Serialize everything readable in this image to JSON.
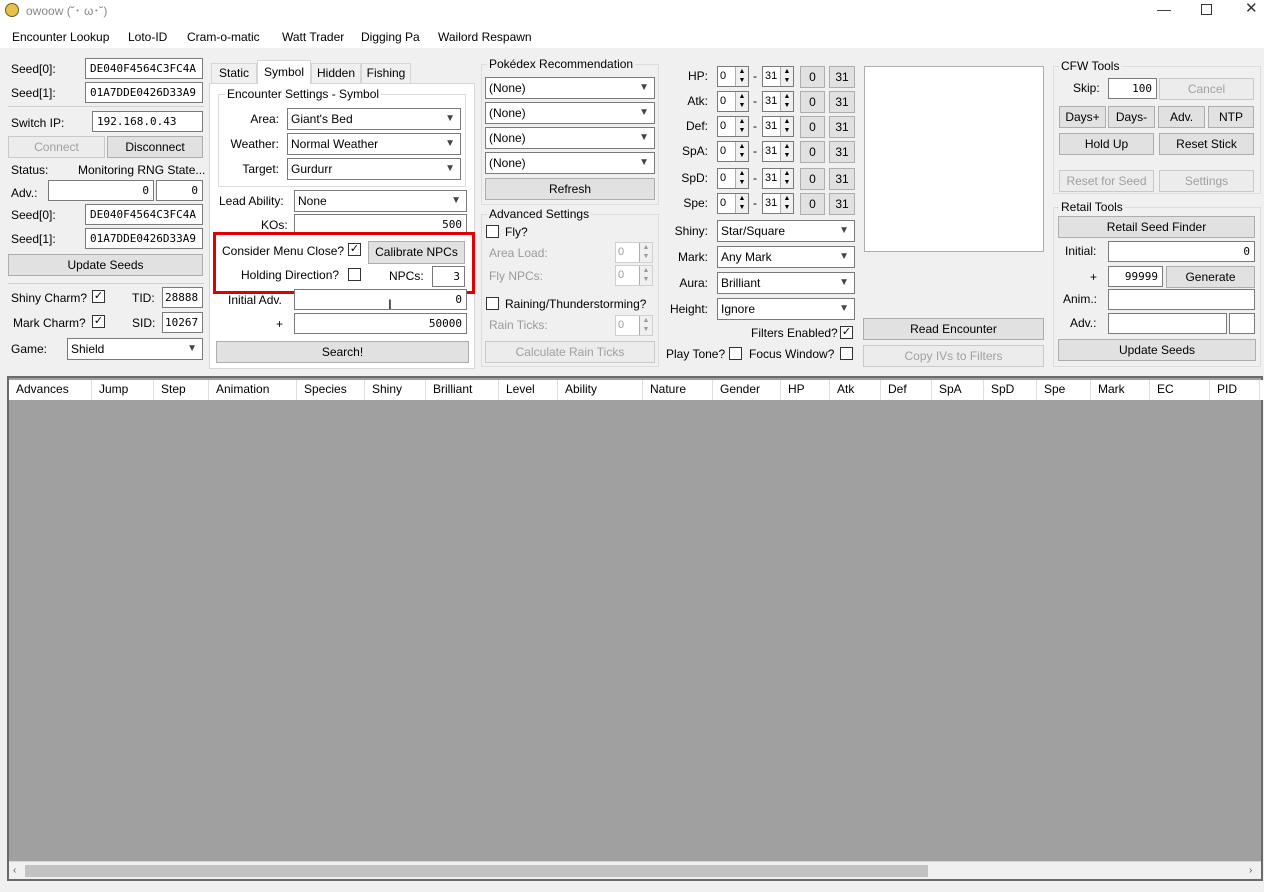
{
  "window": {
    "title": "owoow (˘･ ω･˘)"
  },
  "menu": [
    "Encounter Lookup",
    "Loto-ID",
    "Cram-o-matic",
    "Watt Trader",
    "Digging Pa",
    "Wailord Respawn"
  ],
  "left": {
    "seed0_label": "Seed[0]:",
    "seed0": "DE040F4564C3FC4A",
    "seed1_label": "Seed[1]:",
    "seed1": "01A7DDE0426D33A9",
    "switch_ip_label": "Switch IP:",
    "switch_ip": "192.168.0.43",
    "connect": "Connect",
    "disconnect": "Disconnect",
    "status_label": "Status:",
    "status": "Monitoring RNG State...",
    "adv_label": "Adv.:",
    "adv_a": "0",
    "adv_b": "0",
    "seed0b_label": "Seed[0]:",
    "seed0b": "DE040F4564C3FC4A",
    "seed1b_label": "Seed[1]:",
    "seed1b": "01A7DDE0426D33A9",
    "update_seeds": "Update Seeds",
    "shiny_charm": "Shiny Charm?",
    "tid_label": "TID:",
    "tid": "28888",
    "mark_charm": "Mark Charm?",
    "sid_label": "SID:",
    "sid": "10267",
    "game_label": "Game:",
    "game": "Shield"
  },
  "tabs": [
    "Static",
    "Symbol",
    "Hidden",
    "Fishing"
  ],
  "encounter": {
    "group_title": "Encounter Settings - Symbol",
    "area_label": "Area:",
    "area": "Giant's Bed",
    "weather_label": "Weather:",
    "weather": "Normal Weather",
    "target_label": "Target:",
    "target": "Gurdurr",
    "lead_label": "Lead Ability:",
    "lead": "None",
    "kos_label": "KOs:",
    "kos": "500",
    "menu_close_label": "Consider Menu Close?",
    "calibrate": "Calibrate NPCs",
    "holding_label": "Holding Direction?",
    "npcs_label": "NPCs:",
    "npcs": "3",
    "initial_adv_label": "Initial Adv.",
    "initial_adv": "0",
    "plus_label": "+",
    "plus_value": "50000",
    "search": "Search!"
  },
  "pokedex": {
    "title": "Pokédex Recommendation",
    "options": [
      "(None)",
      "(None)",
      "(None)",
      "(None)"
    ],
    "refresh": "Refresh"
  },
  "advanced": {
    "title": "Advanced Settings",
    "fly_label": "Fly?",
    "area_load_label": "Area Load:",
    "area_load": "0",
    "fly_npcs_label": "Fly NPCs:",
    "fly_npcs": "0",
    "raining_label": "Raining/Thunderstorming?",
    "rain_ticks_label": "Rain Ticks:",
    "rain_ticks": "0",
    "calc_rain": "Calculate Rain Ticks"
  },
  "ivs": {
    "rows": [
      {
        "label": "HP:",
        "min": "0",
        "max": "31",
        "b0": "0",
        "b31": "31"
      },
      {
        "label": "Atk:",
        "min": "0",
        "max": "31",
        "b0": "0",
        "b31": "31"
      },
      {
        "label": "Def:",
        "min": "0",
        "max": "31",
        "b0": "0",
        "b31": "31"
      },
      {
        "label": "SpA:",
        "min": "0",
        "max": "31",
        "b0": "0",
        "b31": "31"
      },
      {
        "label": "SpD:",
        "min": "0",
        "max": "31",
        "b0": "0",
        "b31": "31"
      },
      {
        "label": "Spe:",
        "min": "0",
        "max": "31",
        "b0": "0",
        "b31": "31"
      }
    ],
    "dash": "-"
  },
  "filters": {
    "shiny_label": "Shiny:",
    "shiny": "Star/Square",
    "mark_label": "Mark:",
    "mark": "Any Mark",
    "aura_label": "Aura:",
    "aura": "Brilliant",
    "height_label": "Height:",
    "height": "Ignore",
    "filters_enabled": "Filters Enabled?",
    "play_tone": "Play Tone?",
    "focus_window": "Focus Window?"
  },
  "read": {
    "read_encounter": "Read Encounter",
    "copy_ivs": "Copy IVs to Filters"
  },
  "cfw": {
    "title": "CFW Tools",
    "skip_label": "Skip:",
    "skip": "100",
    "cancel": "Cancel",
    "days_plus": "Days+",
    "days_minus": "Days-",
    "adv": "Adv.",
    "ntp": "NTP",
    "hold_up": "Hold Up",
    "reset_stick": "Reset Stick",
    "reset_for_seed": "Reset for Seed",
    "settings": "Settings"
  },
  "retail": {
    "title": "Retail Tools",
    "finder": "Retail Seed Finder",
    "initial_label": "Initial:",
    "initial": "0",
    "plus_label": "+",
    "plus": "99999",
    "generate": "Generate",
    "anim_label": "Anim.:",
    "adv_label": "Adv.:",
    "update_seeds": "Update Seeds"
  },
  "table": {
    "columns": [
      "Advances",
      "Jump",
      "Step",
      "Animation",
      "Species",
      "Shiny",
      "Brilliant",
      "Level",
      "Ability",
      "Nature",
      "Gender",
      "HP",
      "Atk",
      "Def",
      "SpA",
      "SpD",
      "Spe",
      "Mark",
      "EC",
      "PID"
    ]
  },
  "colors": {
    "highlight": "#e00000",
    "grid_bg": "#a0a0a0",
    "window_bg": "#f0f0f0"
  }
}
